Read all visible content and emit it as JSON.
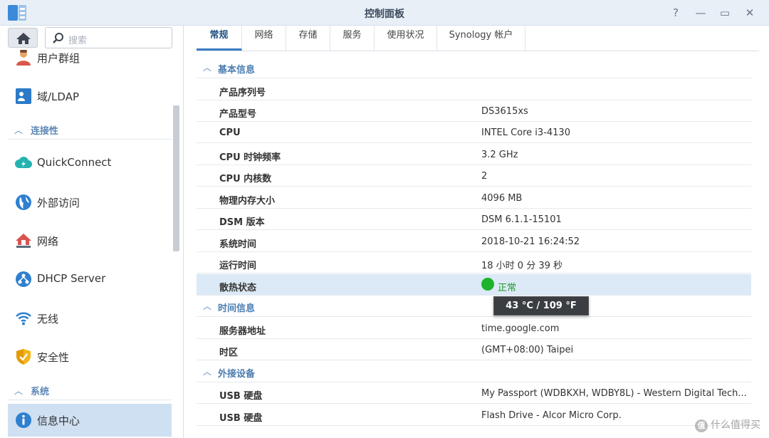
{
  "window": {
    "title": "控制面板",
    "controls": {
      "help": "?",
      "minimize": "—",
      "maximize": "▭",
      "close": "✕"
    }
  },
  "sidebar": {
    "search_placeholder": "搜索",
    "items": [
      {
        "label": "用户群组",
        "icon": "user-group-icon"
      },
      {
        "label": "域/LDAP",
        "icon": "ldap-icon"
      },
      {
        "label": "QuickConnect",
        "icon": "quickconnect-icon"
      },
      {
        "label": "外部访问",
        "icon": "globe-icon"
      },
      {
        "label": "网络",
        "icon": "network-icon"
      },
      {
        "label": "DHCP Server",
        "icon": "dhcp-icon"
      },
      {
        "label": "无线",
        "icon": "wifi-icon"
      },
      {
        "label": "安全性",
        "icon": "shield-icon"
      },
      {
        "label": "信息中心",
        "icon": "info-icon",
        "active": true
      }
    ],
    "sections": {
      "connectivity": "连接性",
      "system": "系统"
    }
  },
  "tabs": [
    "常规",
    "网络",
    "存储",
    "服务",
    "使用状况",
    "Synology 帐户"
  ],
  "groups": {
    "basic": "基本信息",
    "time": "时间信息",
    "external": "外接设备"
  },
  "basic_info": [
    {
      "label": "产品序列号",
      "value": ""
    },
    {
      "label": "产品型号",
      "value": "DS3615xs"
    },
    {
      "label": "CPU",
      "value": "INTEL Core i3-4130"
    },
    {
      "label": "CPU 时钟频率",
      "value": "3.2 GHz"
    },
    {
      "label": "CPU 内核数",
      "value": "2"
    },
    {
      "label": "物理内存大小",
      "value": "4096 MB"
    },
    {
      "label": "DSM 版本",
      "value": "DSM 6.1.1-15101"
    },
    {
      "label": "系统时间",
      "value": "2018-10-21 16:24:52"
    },
    {
      "label": "运行时间",
      "value": "18 小时 0 分 39 秒"
    },
    {
      "label": "散热状态",
      "value": "正常"
    }
  ],
  "tooltip": "43 °C / 109 °F",
  "time_info": [
    {
      "label": "服务器地址",
      "value": "time.google.com"
    },
    {
      "label": "时区",
      "value": "(GMT+08:00) Taipei"
    }
  ],
  "external_devices": [
    {
      "label": "USB 硬盘",
      "value": "My Passport (WDBKXH, WDBY8L) - Western Digital Tech..."
    },
    {
      "label": "USB 硬盘",
      "value": "Flash Drive - Alcor Micro Corp."
    }
  ],
  "watermark": {
    "badge": "值",
    "text": "什么值得买"
  },
  "colors": {
    "accent": "#3b7cc4",
    "status_ok": "#1db32a",
    "highlight": "#dce9f7"
  }
}
